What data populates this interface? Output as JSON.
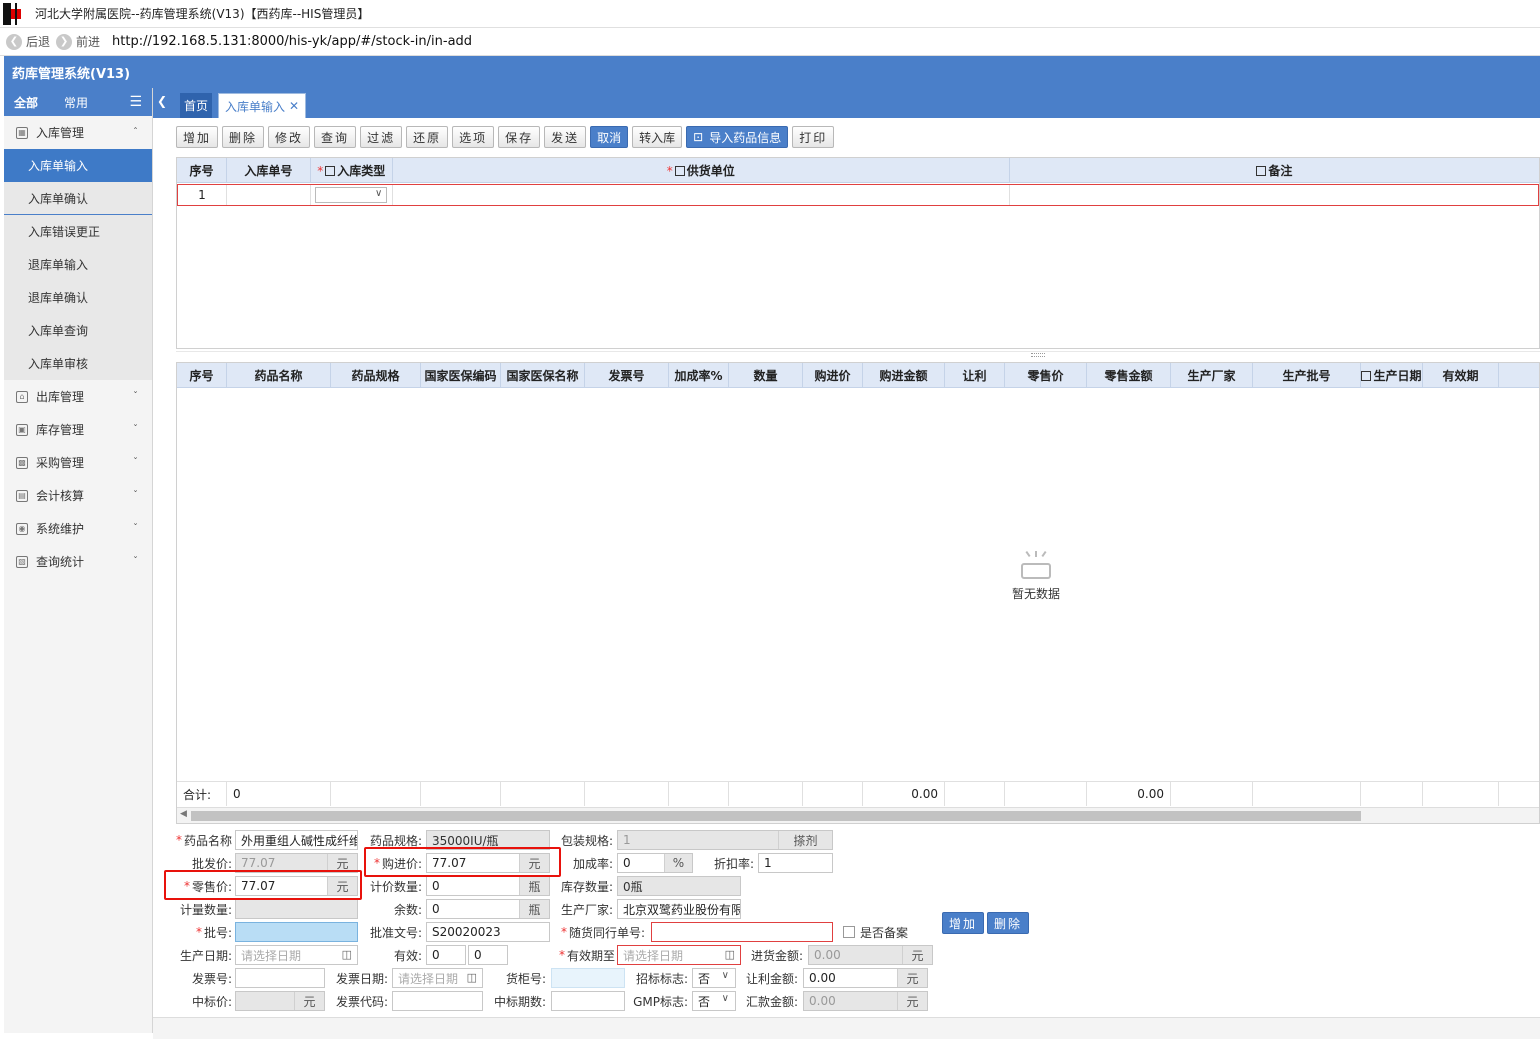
{
  "window": {
    "title": "河北大学附属医院--药库管理系统(V13)【西药库--HIS管理员】"
  },
  "nav": {
    "back": "后退",
    "forward": "前进",
    "url": "http://192.168.5.131:8000/his-yk/app/#/stock-in/in-add"
  },
  "app": {
    "title": "药库管理系统(V13)"
  },
  "sidebar": {
    "tabs": [
      "全部",
      "常用"
    ],
    "groups": [
      {
        "label": "入库管理",
        "items": [
          "入库单输入",
          "入库单确认",
          "入库错误更正",
          "退库单输入",
          "退库单确认",
          "入库单查询",
          "入库单审核"
        ]
      },
      {
        "label": "出库管理"
      },
      {
        "label": "库存管理"
      },
      {
        "label": "采购管理"
      },
      {
        "label": "会计核算"
      },
      {
        "label": "系统维护"
      },
      {
        "label": "查询统计"
      }
    ]
  },
  "tabs": {
    "home": "首页",
    "current": "入库单输入"
  },
  "toolbar": [
    "增加",
    "删除",
    "修改",
    "查询",
    "过滤",
    "还原",
    "选项",
    "保存",
    "发送",
    "取消",
    "转入库",
    "导入药品信息",
    "打印"
  ],
  "grid1": {
    "columns": [
      "序号",
      "入库单号",
      "入库类型",
      "供货单位",
      "备注"
    ],
    "rows": [
      {
        "seq": "1"
      }
    ]
  },
  "grid2": {
    "columns": [
      "序号",
      "药品名称",
      "药品规格",
      "国家医保编码",
      "国家医保名称",
      "发票号",
      "加成率%",
      "数量",
      "购进价",
      "购进金额",
      "让利",
      "零售价",
      "零售金额",
      "生产厂家",
      "生产批号",
      "生产日期",
      "有效期"
    ],
    "empty_text": "暂无数据",
    "totals": {
      "label": "合计:",
      "count": "0",
      "amount1": "0.00",
      "amount2": "0.00"
    }
  },
  "form": {
    "drug_name_label": "药品名称",
    "drug_name": "外用重组人碱性成纤维",
    "spec_label": "药品规格:",
    "spec": "35000IU/瓶",
    "pack_label": "包装规格:",
    "pack": "1",
    "pack_unit": "搽剂",
    "wholesale_label": "批发价:",
    "wholesale": "77.07",
    "yuan": "元",
    "purchase_label": "购进价:",
    "purchase": "77.07",
    "markup_label": "加成率:",
    "markup": "0",
    "percent": "%",
    "discount_label": "折扣率:",
    "discount": "1",
    "retail_label": "零售价:",
    "retail": "77.07",
    "price_qty_label": "计价数量:",
    "price_qty": "0",
    "bottle": "瓶",
    "stock_qty_label": "库存数量:",
    "stock_qty": "0瓶",
    "measure_qty_label": "计量数量:",
    "remain_label": "余数:",
    "remain": "0",
    "maker_label": "生产厂家:",
    "maker": "北京双鹭药业股份有限公司",
    "batch_label": "批号:",
    "approval_label": "批准文号:",
    "approval": "S20020023",
    "accomp_label": "随货同行单号:",
    "filing_label": "是否备案",
    "add_btn": "增加",
    "del_btn": "删除",
    "prod_date_label": "生产日期:",
    "date_ph": "请选择日期",
    "valid_label": "有效:",
    "valid1": "0",
    "valid2": "0",
    "expiry_label": "有效期至",
    "in_amount_label": "进货金额:",
    "in_amount": "0.00",
    "invoice_no_label": "发票号:",
    "invoice_date_label": "发票日期:",
    "cabinet_label": "货柜号:",
    "tender_label": "招标标志:",
    "tender": "否",
    "rebate_label": "让利金额:",
    "rebate": "0.00",
    "bid_price_label": "中标价:",
    "invoice_code_label": "发票代码:",
    "bid_period_label": "中标期数:",
    "gmp_label": "GMP标志:",
    "gmp": "否",
    "summary_label": "汇款金额:",
    "summary": "0.00"
  },
  "colors": {
    "header": "#4a7fc9",
    "highlight": "#e8120c"
  }
}
